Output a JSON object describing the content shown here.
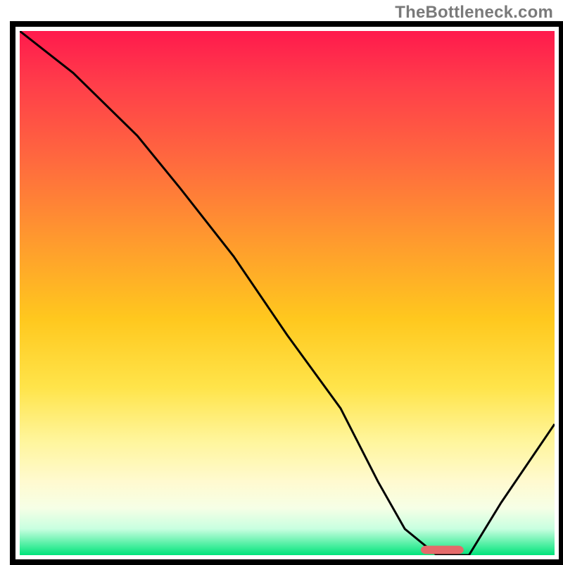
{
  "watermark": "TheBottleneck.com",
  "chart_data": {
    "type": "line",
    "title": "",
    "xlabel": "",
    "ylabel": "",
    "xlim": [
      0,
      100
    ],
    "ylim": [
      0,
      100
    ],
    "grid": false,
    "legend": false,
    "series": [
      {
        "name": "bottleneck-curve",
        "x": [
          0,
          10,
          22,
          30,
          40,
          50,
          60,
          67,
          72,
          78,
          84,
          90,
          100
        ],
        "y": [
          100,
          92,
          80,
          70,
          57,
          42,
          28,
          14,
          5,
          0,
          0,
          10,
          25
        ]
      }
    ],
    "marker": {
      "name": "optimal-range",
      "x_start": 75,
      "x_end": 83,
      "y": 1
    },
    "colors": {
      "curve": "#000000",
      "marker": "#e46a6a"
    }
  }
}
